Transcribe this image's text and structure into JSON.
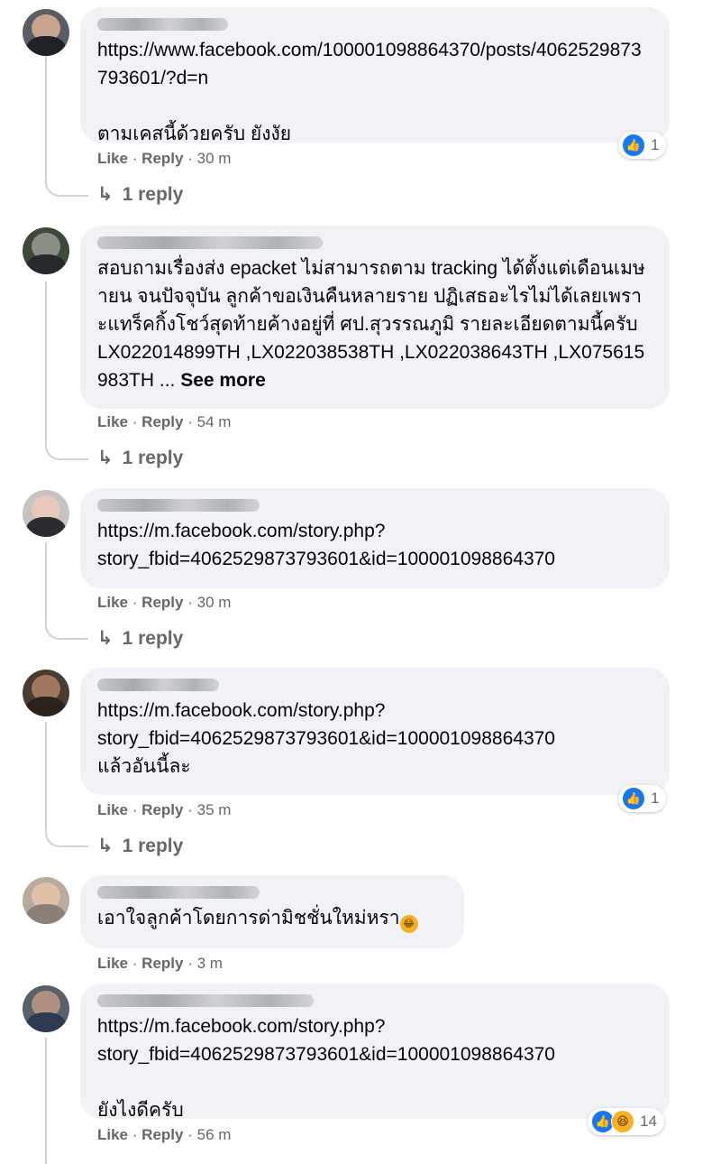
{
  "labels": {
    "like": "Like",
    "reply": "Reply",
    "dot": "·"
  },
  "colors": {
    "bubble": "#f0f2f5",
    "meta": "#65676b",
    "like_blue": "#1877f2",
    "haha_yellow": "#f7b125"
  },
  "comments": [
    {
      "text": "https://www.facebook.com/100001098864370/posts/4062529873793601/?d=n\n\nตามเคสนี้ด้วยครับ ยังงัย",
      "time": "30 m",
      "reaction_count": "1",
      "reaction_icons": [
        "like-icon"
      ],
      "reply_label": "1 reply"
    },
    {
      "text": "สอบถามเรื่องส่ง epacket ไม่สามารถตาม tracking ได้ตั้งแต่เดือนเมษายน จนปัจจุบัน ลูกค้าขอเงินคืนหลายราย ปฏิเสธอะไรไม่ได้เลยเพราะแทร็คกิ้งโชว์สุดท้ายค้างอยู่ที่ ศป.สุวรรณภูมิ รายละเอียดตามนี้ครับ LX022014899TH ,LX022038538TH ,LX022038643TH ,LX075615983TH ... ",
      "see_more": "See more",
      "time": "54 m",
      "reply_label": "1 reply"
    },
    {
      "text": "https://m.facebook.com/story.php?\nstory_fbid=4062529873793601&id=100001098864370",
      "time": "30 m",
      "reply_label": "1 reply"
    },
    {
      "text": "https://m.facebook.com/story.php?\nstory_fbid=4062529873793601&id=100001098864370\nแล้วอันนี้ละ",
      "time": "35 m",
      "reaction_count": "1",
      "reaction_icons": [
        "like-icon"
      ],
      "reply_label": "1 reply"
    },
    {
      "text": "เอาใจลูกค้าโดยการด่ามิชชั่นใหม่หรา",
      "emoji": "rolling-laughing-emoji",
      "time": "3 m"
    },
    {
      "text": "https://m.facebook.com/story.php?\nstory_fbid=4062529873793601&id=100001098864370\n\nยังไงดีครับ",
      "time": "56 m",
      "reaction_count": "14",
      "reaction_icons": [
        "like-icon",
        "haha-icon"
      ]
    }
  ]
}
